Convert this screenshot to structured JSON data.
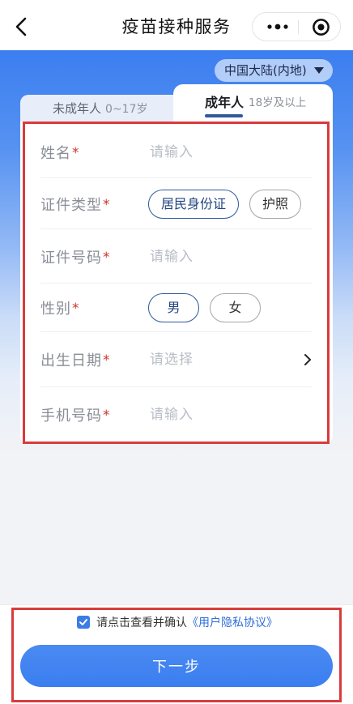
{
  "header": {
    "title": "疫苗接种服务",
    "icons": {
      "back": "back-arrow-icon",
      "more": "more-dots-icon",
      "close": "mini-program-close-icon"
    }
  },
  "region_selector": {
    "value": "中国大陆(内地)",
    "icon": "caret-down-icon"
  },
  "tabs": [
    {
      "label": "未成年人",
      "range": "0~17岁",
      "active": false
    },
    {
      "label": "成年人",
      "range": "18岁及以上",
      "active": true
    }
  ],
  "form": {
    "name": {
      "label": "姓名",
      "required_mark": "*",
      "placeholder": "请输入"
    },
    "id_type": {
      "label": "证件类型",
      "required_mark": "*",
      "options": [
        "居民身份证",
        "护照"
      ],
      "selected_index": 0
    },
    "id_number": {
      "label": "证件号码",
      "required_mark": "*",
      "placeholder": "请输入"
    },
    "gender": {
      "label": "性别",
      "required_mark": "*",
      "options": [
        "男",
        "女"
      ],
      "selected_index": 0
    },
    "birth_date": {
      "label": "出生日期",
      "required_mark": "*",
      "placeholder": "请选择",
      "icon": "chevron-right-icon"
    },
    "phone": {
      "label": "手机号码",
      "required_mark": "*",
      "placeholder": "请输入"
    }
  },
  "agreement": {
    "checked": true,
    "prefix": "请点击查看并确认",
    "link": "《用户隐私协议》"
  },
  "actions": {
    "next_label": "下一步"
  },
  "colors": {
    "brand_blue": "#3b7ef0",
    "selected_chip": "#2f5a9c",
    "required_red": "#c8372d",
    "link_blue": "#2f6fd6",
    "annotation_red": "#d93b3b"
  }
}
